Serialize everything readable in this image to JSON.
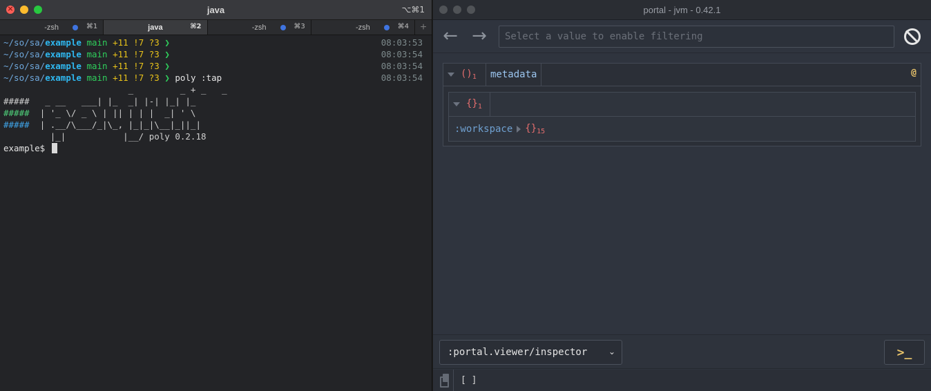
{
  "terminal": {
    "title": "java",
    "shortcut": "⌥⌘1",
    "tabs": [
      {
        "label": "-zsh",
        "kbd": "⌘1",
        "active": false
      },
      {
        "label": "java",
        "kbd": "⌘2",
        "active": true
      },
      {
        "label": "-zsh",
        "kbd": "⌘3",
        "active": false
      },
      {
        "label": "-zsh",
        "kbd": "⌘4",
        "active": false
      }
    ],
    "add_tab": "+",
    "prompt": {
      "tilde": "~",
      "path_dim": "/so/sa/",
      "path_bold": "example",
      "branch": "main",
      "status": "+11 !7 ?3",
      "chevron": "❯"
    },
    "lines": [
      {
        "command": "",
        "time": "08:03:53"
      },
      {
        "command": "",
        "time": "08:03:54"
      },
      {
        "command": "",
        "time": "08:03:54"
      },
      {
        "command": "poly :tap",
        "time": "08:03:54"
      }
    ],
    "art": {
      "l0": "                        _         _ + _   _",
      "l1h": "#####",
      "l1": "   _ __   ___| |_  _| |-| |_| |_",
      "l2h": "#####",
      "l2": "  | '_ \\/ _ \\ | || | | |  _| ' \\",
      "l3h": "#####",
      "l3": "  | .__/\\___/_|\\_, |_|_|\\__|_||_|",
      "l4": "         |_|           |__/ poly 0.2.18"
    },
    "shell_prompt": "example$ "
  },
  "portal": {
    "title": "portal - jvm - 0.42.1",
    "back_icon": "←",
    "forward_icon": "→",
    "filter_placeholder": "Select a value to enable filtering",
    "outer": {
      "coll": "()",
      "count": "1",
      "key": "metadata",
      "at": "@"
    },
    "inner": {
      "coll": "{}",
      "count": "1",
      "entry_key": ":workspace",
      "entry_coll": "{}",
      "entry_count": "15"
    },
    "viewer_select": ":portal.viewer/inspector",
    "select_chevron": "⌄",
    "command_button": ">_",
    "footer_value": "[ ]"
  },
  "colors": {
    "accent_blue": "#3f74e0",
    "prompt_path": "#2fb8f0",
    "prompt_branch": "#2fcf5c",
    "prompt_status": "#e8c21a",
    "portal_coll": "#e26d6d",
    "portal_key": "#9cc6f0",
    "portal_accent": "#e8c36a"
  }
}
